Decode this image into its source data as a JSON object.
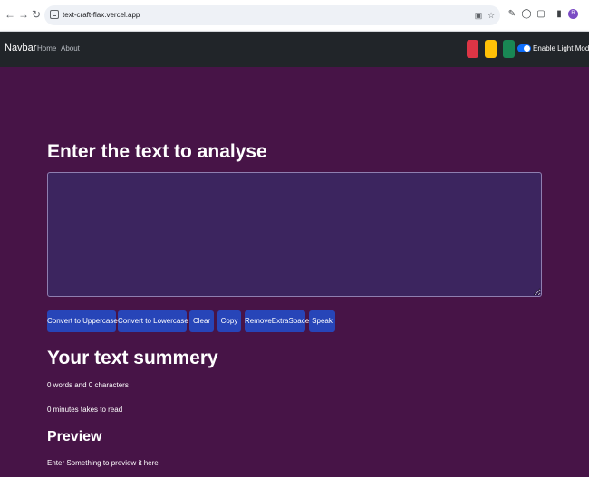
{
  "browser": {
    "url": "text-craft-flax.vercel.app",
    "avatar_letter": "R"
  },
  "navbar": {
    "brand": "Navbar",
    "links": [
      "Home",
      "About"
    ],
    "theme_colors": [
      "#dc3545",
      "#ffc107",
      "#198754"
    ],
    "mode_toggle_label": "Enable Light Mode"
  },
  "main": {
    "heading": "Enter the text to analyse",
    "textarea_value": "",
    "buttons": [
      "Convert to Uppercase",
      "Convert to Lowercase",
      "Clear",
      "Copy",
      "RemoveExtraSpace",
      "Speak"
    ],
    "summary_heading": "Your text summery",
    "word_count_text": "0 words and 0 characters",
    "read_time_text": "0 minutes takes to read",
    "preview_heading": "Preview",
    "preview_text": "Enter Something to preview it here"
  },
  "colors": {
    "background": "#471447",
    "navbar": "#212529",
    "textarea": "#3c255f",
    "button": "#2745b8"
  }
}
